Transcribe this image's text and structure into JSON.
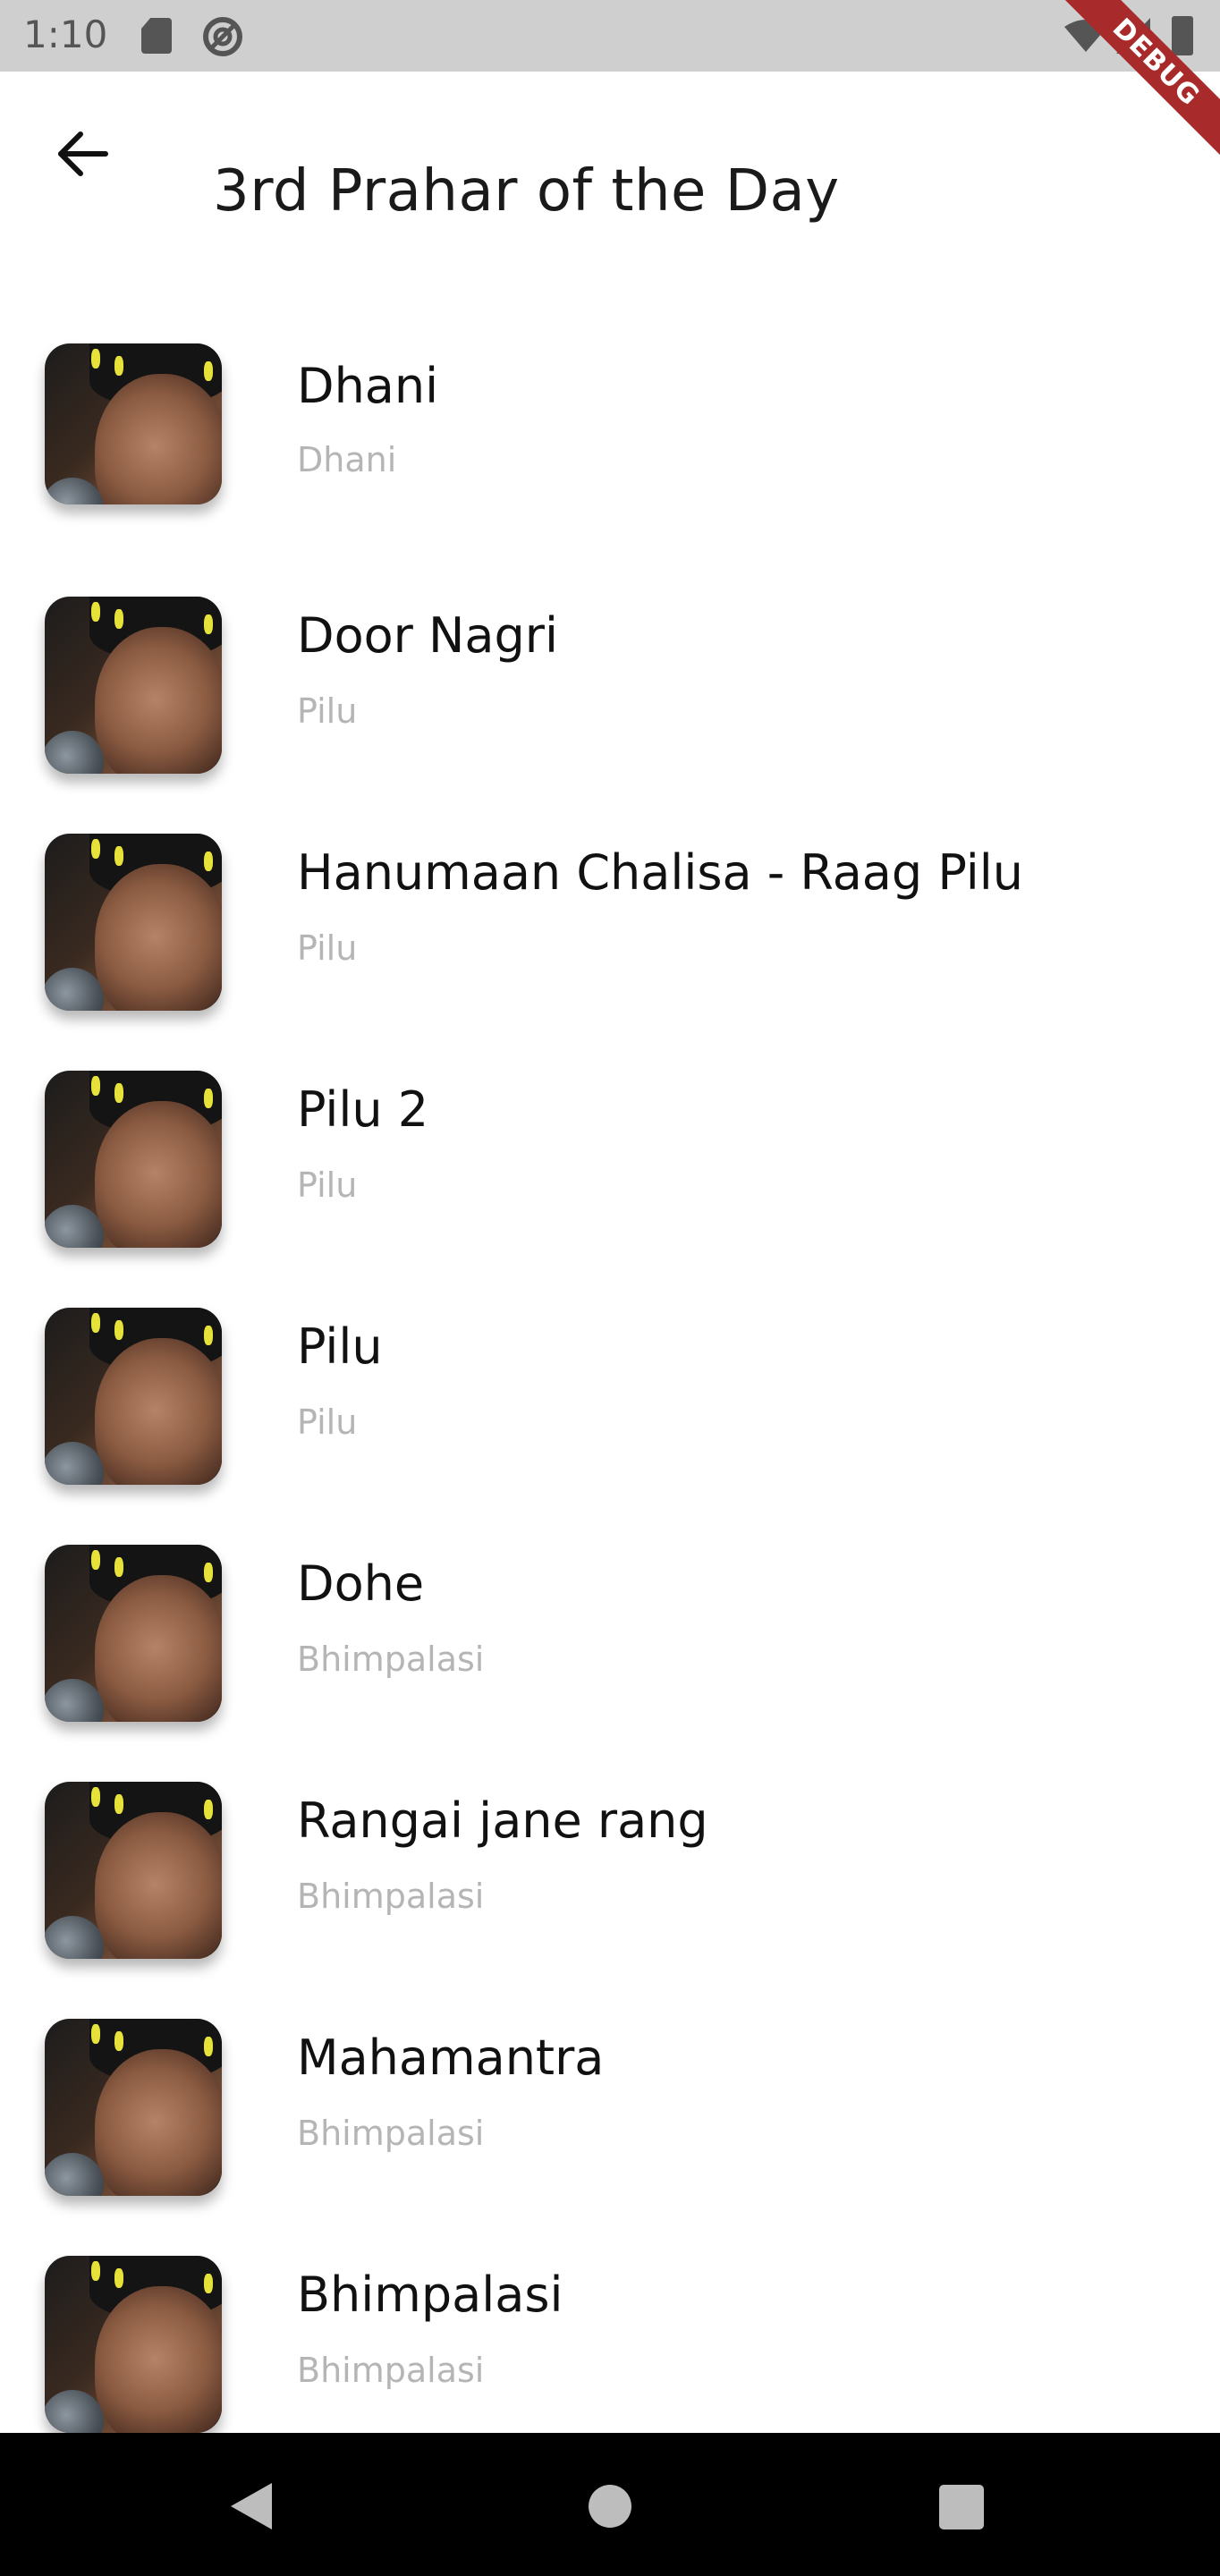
{
  "status_bar": {
    "time": "1:10",
    "icons": [
      "sd-card-icon",
      "at-sign-icon",
      "wifi-icon",
      "signal-icon",
      "battery-icon"
    ]
  },
  "debug_banner": "DEBUG",
  "app_bar": {
    "title": "3rd Prahar of the Day",
    "back_icon": "arrow-left-icon"
  },
  "tracks": [
    {
      "title": "Dhani",
      "raag": "Dhani"
    },
    {
      "title": "Door Nagri",
      "raag": "Pilu"
    },
    {
      "title": "Hanumaan Chalisa - Raag Pilu",
      "raag": "Pilu"
    },
    {
      "title": "Pilu 2",
      "raag": "Pilu"
    },
    {
      "title": "Pilu",
      "raag": "Pilu"
    },
    {
      "title": "Dohe",
      "raag": "Bhimpalasi"
    },
    {
      "title": "Rangai jane rang",
      "raag": "Bhimpalasi"
    },
    {
      "title": "Mahamantra",
      "raag": "Bhimpalasi"
    },
    {
      "title": "Bhimpalasi",
      "raag": "Bhimpalasi"
    }
  ],
  "nav_bar": {
    "icons": [
      "nav-back-icon",
      "nav-home-icon",
      "nav-recents-icon"
    ]
  },
  "colors": {
    "status_bar_bg": "#cfcfcf",
    "title_text": "#111111",
    "subtitle_text": "#b5b5b5",
    "debug_ribbon": "#a82a2a",
    "nav_bar_bg": "#000000"
  }
}
